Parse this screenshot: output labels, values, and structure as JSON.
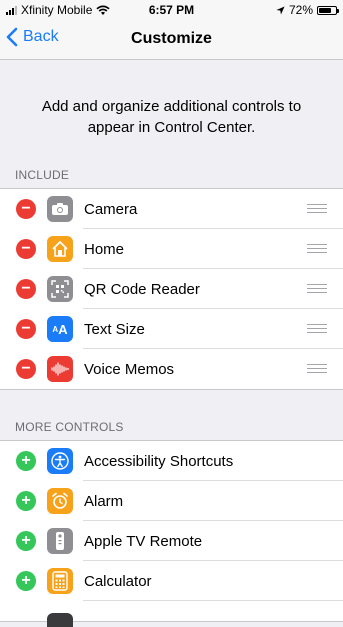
{
  "status_bar": {
    "carrier": "Xfinity Mobile",
    "time": "6:57 PM",
    "battery": "72%",
    "battery_level": 0.72
  },
  "nav": {
    "back_label": "Back",
    "title": "Customize"
  },
  "description": "Add and organize additional controls to appear in Control Center.",
  "include": {
    "header": "INCLUDE",
    "items": [
      {
        "label": "Camera",
        "icon": "camera-icon",
        "color": "#8e8e93"
      },
      {
        "label": "Home",
        "icon": "home-icon",
        "color": "#f7a21b"
      },
      {
        "label": "QR Code Reader",
        "icon": "qr-code-icon",
        "color": "#8e8e93"
      },
      {
        "label": "Text Size",
        "icon": "text-size-icon",
        "color": "#1a7cf7",
        "glyph": "AA"
      },
      {
        "label": "Voice Memos",
        "icon": "voice-memos-icon",
        "color": "#eb3b33"
      }
    ]
  },
  "more_controls": {
    "header": "MORE CONTROLS",
    "items": [
      {
        "label": "Accessibility Shortcuts",
        "icon": "accessibility-icon",
        "color": "#1a7cf7"
      },
      {
        "label": "Alarm",
        "icon": "alarm-icon",
        "color": "#f7a21b"
      },
      {
        "label": "Apple TV Remote",
        "icon": "tv-remote-icon",
        "color": "#8e8e93"
      },
      {
        "label": "Calculator",
        "icon": "calculator-icon",
        "color": "#f7a21b"
      }
    ]
  }
}
